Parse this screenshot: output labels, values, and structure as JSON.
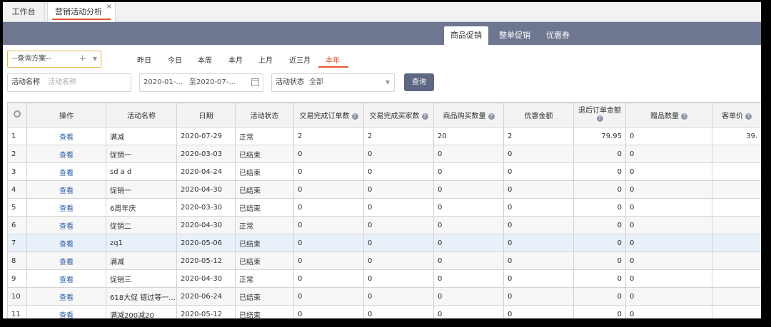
{
  "tabs": {
    "home": "工作台",
    "active": "营销活动分析",
    "close": "×"
  },
  "nav": {
    "product": "商品促销",
    "order": "整单促销",
    "coupon": "优惠券"
  },
  "scheme": {
    "label": "--查询方案--",
    "plus": "+",
    "caret": "▼"
  },
  "quick_ranges": [
    "昨日",
    "今日",
    "本周",
    "本月",
    "上月",
    "近三月",
    "本年"
  ],
  "filters": {
    "name_label": "活动名称",
    "name_placeholder": "活动名称",
    "date_from": "2020-01-...",
    "date_to": "至2020-07-...",
    "status_label": "活动状态",
    "status_value": "全部"
  },
  "query_button": "查询",
  "table": {
    "columns": [
      "",
      "操作",
      "活动名称",
      "日期",
      "活动状态",
      "交易完成订单数",
      "交易完成买家数",
      "商品购买数量",
      "优惠金额",
      "退后订单金额",
      "赠品数量",
      "客单价"
    ],
    "help_mark": "?",
    "rows": [
      [
        "1",
        "查看",
        "满减",
        "2020-07-29",
        "正常",
        "2",
        "2",
        "20",
        "2",
        "79.95",
        "0",
        "39."
      ],
      [
        "2",
        "查看",
        "促销一",
        "2020-03-03",
        "已结束",
        "0",
        "0",
        "0",
        "0",
        "0",
        "0",
        ""
      ],
      [
        "3",
        "查看",
        "sd a d",
        "2020-04-24",
        "已结束",
        "0",
        "0",
        "0",
        "0",
        "0",
        "0",
        ""
      ],
      [
        "4",
        "查看",
        "促销一",
        "2020-04-30",
        "已结束",
        "0",
        "0",
        "0",
        "0",
        "0",
        "0",
        ""
      ],
      [
        "5",
        "查看",
        "6周年庆",
        "2020-03-30",
        "已结束",
        "0",
        "0",
        "0",
        "0",
        "0",
        "0",
        ""
      ],
      [
        "6",
        "查看",
        "促销二",
        "2020-04-30",
        "正常",
        "0",
        "0",
        "0",
        "0",
        "0",
        "0",
        ""
      ],
      [
        "7",
        "查看",
        "zq1",
        "2020-05-06",
        "已结束",
        "0",
        "0",
        "0",
        "0",
        "0",
        "0",
        ""
      ],
      [
        "8",
        "查看",
        "满减",
        "2020-05-12",
        "已结束",
        "0",
        "0",
        "0",
        "0",
        "0",
        "0",
        ""
      ],
      [
        "9",
        "查看",
        "促销三",
        "2020-04-30",
        "正常",
        "0",
        "0",
        "0",
        "0",
        "0",
        "0",
        ""
      ],
      [
        "10",
        "查看",
        "618大促 错过等一...",
        "2020-06-24",
        "已结束",
        "0",
        "0",
        "0",
        "0",
        "0",
        "0",
        ""
      ],
      [
        "11",
        "查看",
        "满减200减20",
        "2020-05-12",
        "已结束",
        "0",
        "0",
        "0",
        "0",
        "0",
        "0",
        ""
      ]
    ]
  },
  "colors": {
    "accent": "#e4572e",
    "nav_band": "#6f7690",
    "link": "#2c5ea8",
    "button": "#5f6882",
    "highlight_row": "#e8f1fa"
  }
}
